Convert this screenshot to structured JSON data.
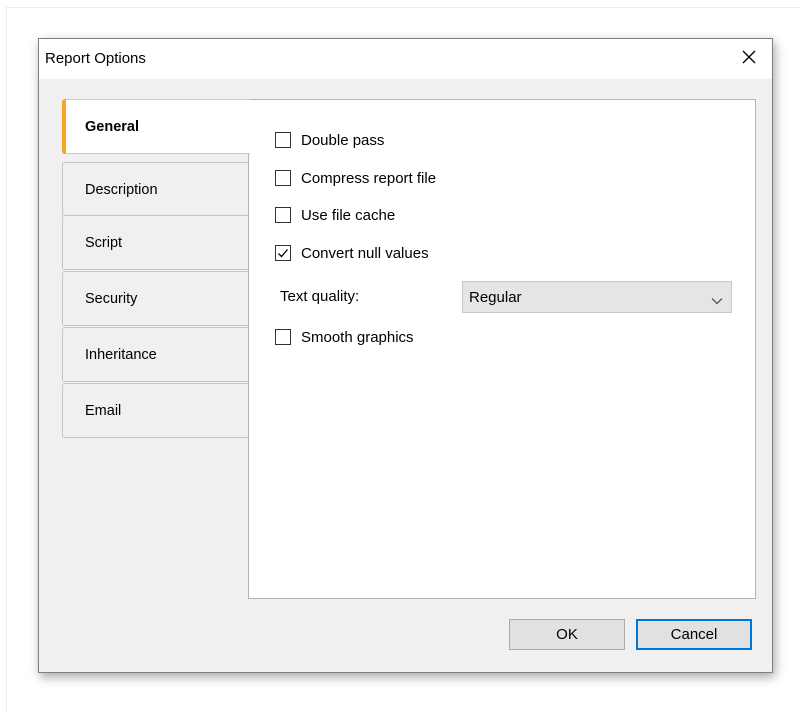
{
  "dialog": {
    "title": "Report Options",
    "close_icon": "close-icon"
  },
  "tabs": [
    {
      "label": "General",
      "active": true
    },
    {
      "label": "Description",
      "active": false
    },
    {
      "label": "Script",
      "active": false
    },
    {
      "label": "Security",
      "active": false
    },
    {
      "label": "Inheritance",
      "active": false
    },
    {
      "label": "Email",
      "active": false
    }
  ],
  "general": {
    "double_pass": {
      "label": "Double pass",
      "checked": false
    },
    "compress_report_file": {
      "label": "Compress report file",
      "checked": false
    },
    "use_file_cache": {
      "label": "Use file cache",
      "checked": false
    },
    "convert_null_values": {
      "label": "Convert null values",
      "checked": true
    },
    "text_quality": {
      "label": "Text quality:",
      "value": "Regular"
    },
    "smooth_graphics": {
      "label": "Smooth graphics",
      "checked": false
    }
  },
  "buttons": {
    "ok": "OK",
    "cancel": "Cancel"
  },
  "colors": {
    "active_tab_accent": "#f5a623",
    "default_button_border": "#0078d7"
  }
}
